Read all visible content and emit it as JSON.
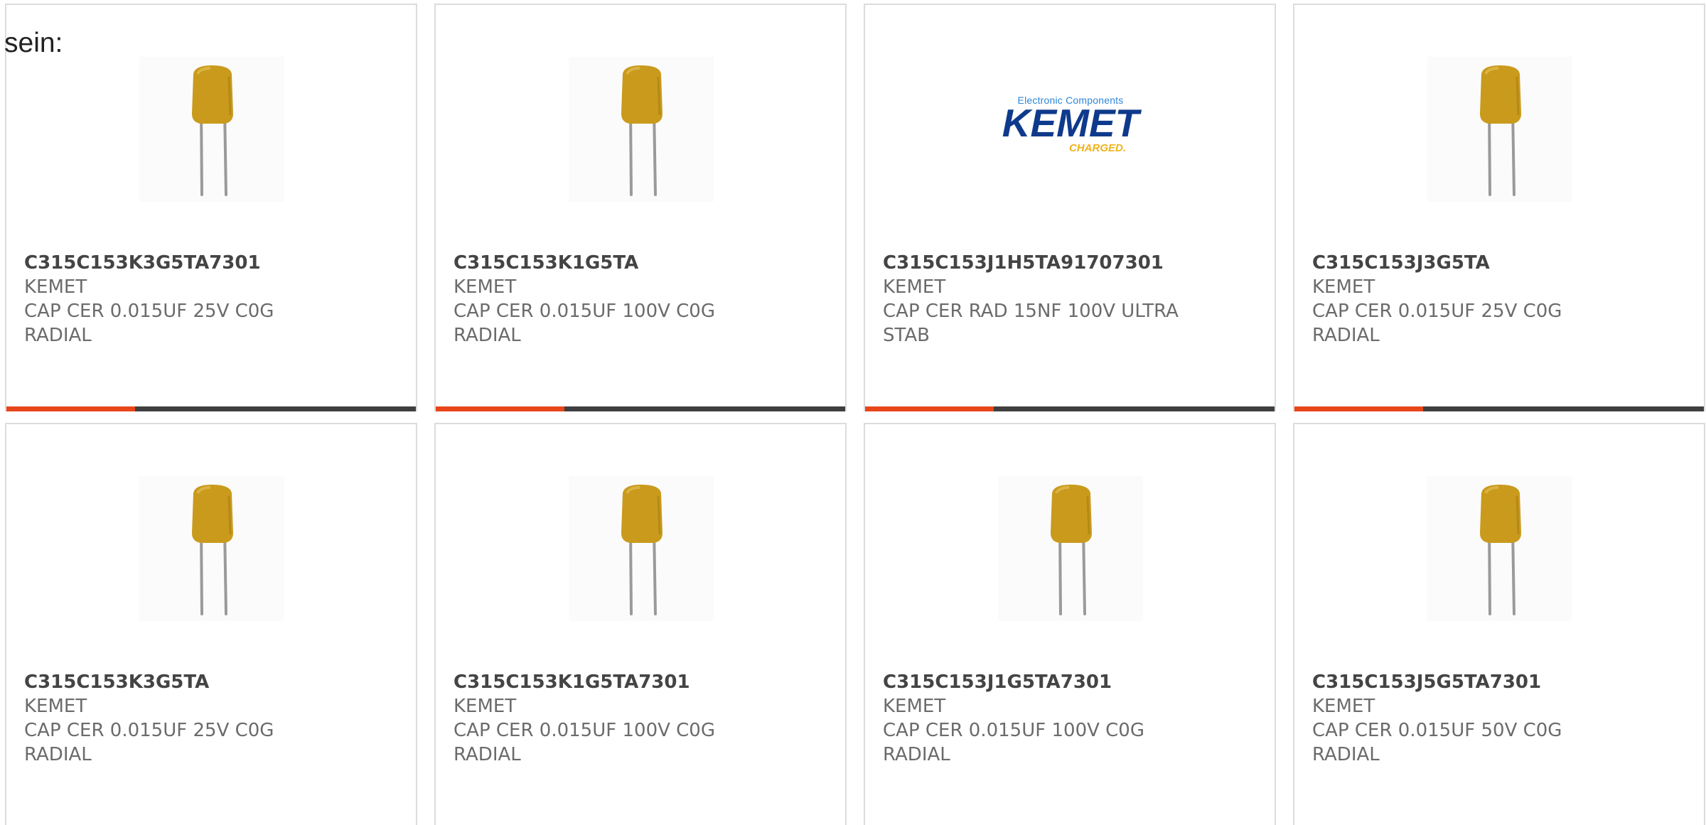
{
  "intro": "sein:",
  "colors": {
    "capacitor_body": "#c99a1c",
    "accent_bar": "#e8461a",
    "dark_bar": "#3f3f3f",
    "kemet_blue": "#0f3a8c",
    "kemet_tagline": "#f0b21a"
  },
  "logo": {
    "small": "Electronic Components",
    "big": "KEMET",
    "tag": "CHARGED."
  },
  "products": [
    {
      "part": "C315C153K3G5TA7301",
      "mfr": "KEMET",
      "desc": "CAP CER 0.015UF 25V C0G RADIAL",
      "image": "radial-capacitor-icon"
    },
    {
      "part": "C315C153K1G5TA",
      "mfr": "KEMET",
      "desc": "CAP CER 0.015UF 100V C0G RADIAL",
      "image": "radial-capacitor-icon"
    },
    {
      "part": "C315C153J1H5TA91707301",
      "mfr": "KEMET",
      "desc": "CAP CER RAD 15NF 100V ULTRA STAB",
      "image": "kemet-logo"
    },
    {
      "part": "C315C153J3G5TA",
      "mfr": "KEMET",
      "desc": "CAP CER 0.015UF 25V C0G RADIAL",
      "image": "radial-capacitor-icon"
    },
    {
      "part": "C315C153K3G5TA",
      "mfr": "KEMET",
      "desc": "CAP CER 0.015UF 25V C0G RADIAL",
      "image": "radial-capacitor-icon"
    },
    {
      "part": "C315C153K1G5TA7301",
      "mfr": "KEMET",
      "desc": "CAP CER 0.015UF 100V C0G RADIAL",
      "image": "radial-capacitor-icon"
    },
    {
      "part": "C315C153J1G5TA7301",
      "mfr": "KEMET",
      "desc": "CAP CER 0.015UF 100V C0G RADIAL",
      "image": "radial-capacitor-icon"
    },
    {
      "part": "C315C153J5G5TA7301",
      "mfr": "KEMET",
      "desc": "CAP CER 0.015UF 50V C0G RADIAL",
      "image": "radial-capacitor-icon"
    }
  ]
}
